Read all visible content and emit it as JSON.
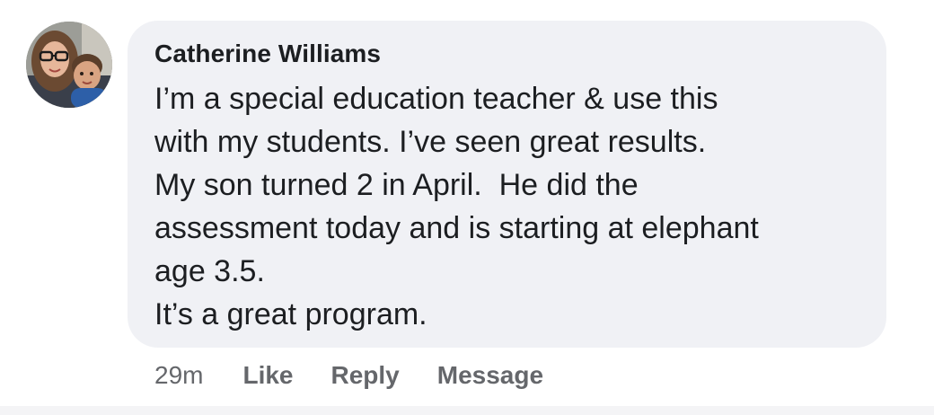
{
  "comment": {
    "author": "Catherine Williams",
    "lines": [
      "I’m a special education teacher & use this",
      "with my students. I’ve seen great results.",
      "My son turned 2 in April.  He did the",
      "assessment today and is starting at elephant",
      "age 3.5.",
      "It’s a great program."
    ],
    "timestamp": "29m"
  },
  "actions": {
    "like": "Like",
    "reply": "Reply",
    "message": "Message"
  },
  "colors": {
    "bubble_background": "#f0f1f5",
    "text_primary": "#1c1e21",
    "text_secondary": "#65676b"
  }
}
